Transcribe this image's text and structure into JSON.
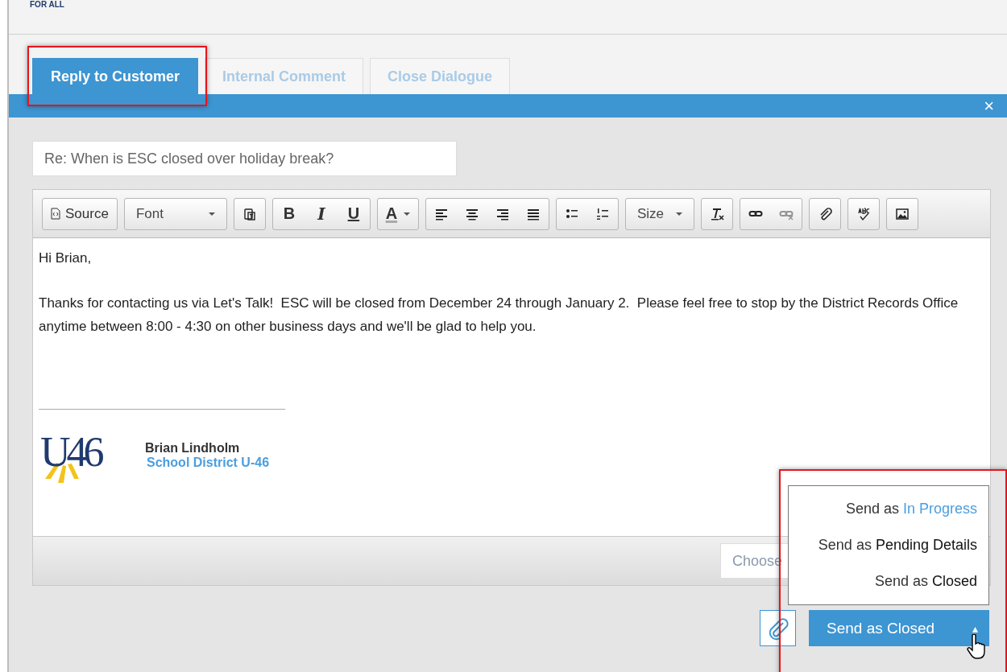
{
  "header": {
    "brand_text": "FOR ALL"
  },
  "tabs": [
    {
      "label": "Reply to Customer",
      "selected": true
    },
    {
      "label": "Internal Comment",
      "selected": false
    },
    {
      "label": "Close Dialogue",
      "selected": false
    }
  ],
  "close_label": "×",
  "subject": {
    "value": "Re: When is ESC closed over holiday break?"
  },
  "toolbar": [
    [
      {
        "kind": "source",
        "label": "Source",
        "disabled": false
      }
    ],
    [
      {
        "kind": "combo",
        "label": "Font",
        "disabled": false
      }
    ],
    [
      {
        "kind": "paste",
        "disabled": false
      }
    ],
    [
      {
        "kind": "bold",
        "label": "B",
        "disabled": false
      },
      {
        "kind": "italic",
        "label": "I",
        "disabled": false
      },
      {
        "kind": "underline",
        "label": "U",
        "disabled": false
      }
    ],
    [
      {
        "kind": "color",
        "label": "A",
        "disabled": false
      }
    ],
    [
      {
        "kind": "align-left",
        "disabled": false
      },
      {
        "kind": "align-center",
        "disabled": false
      },
      {
        "kind": "align-right",
        "disabled": false
      },
      {
        "kind": "justify",
        "disabled": false
      }
    ],
    [
      {
        "kind": "bullets",
        "disabled": false
      },
      {
        "kind": "numbers",
        "disabled": false
      }
    ],
    [
      {
        "kind": "combo",
        "label": "Size",
        "disabled": false
      }
    ],
    [
      {
        "kind": "clear-format",
        "disabled": false
      }
    ],
    [
      {
        "kind": "link",
        "disabled": false
      },
      {
        "kind": "unlink",
        "disabled": true
      }
    ],
    [
      {
        "kind": "attach",
        "disabled": false
      }
    ],
    [
      {
        "kind": "spellcheck",
        "disabled": false
      }
    ],
    [
      {
        "kind": "image",
        "disabled": false
      }
    ]
  ],
  "body": {
    "paragraphs": [
      "Hi Brian,",
      "Thanks for contacting us via Let's Talk!  ESC will be closed from December 24 through January 2.  Please feel free to stop by the District Records Office anytime between 8:00 - 4:30 on other business days and we'll be glad to help you."
    ],
    "signature": {
      "logo_text": "U46",
      "name": "Brian Lindholm",
      "organization": "School District U-46"
    }
  },
  "template_select": {
    "placeholder": "Choose"
  },
  "send_menu": [
    {
      "prefix": "Send as",
      "status": "In Progress",
      "hovered": true
    },
    {
      "prefix": "Send as",
      "status": "Pending Details",
      "hovered": false
    },
    {
      "prefix": "Send as",
      "status": "Closed",
      "hovered": false
    }
  ],
  "send_button": {
    "label": "Send as Closed",
    "caret": "▴"
  }
}
